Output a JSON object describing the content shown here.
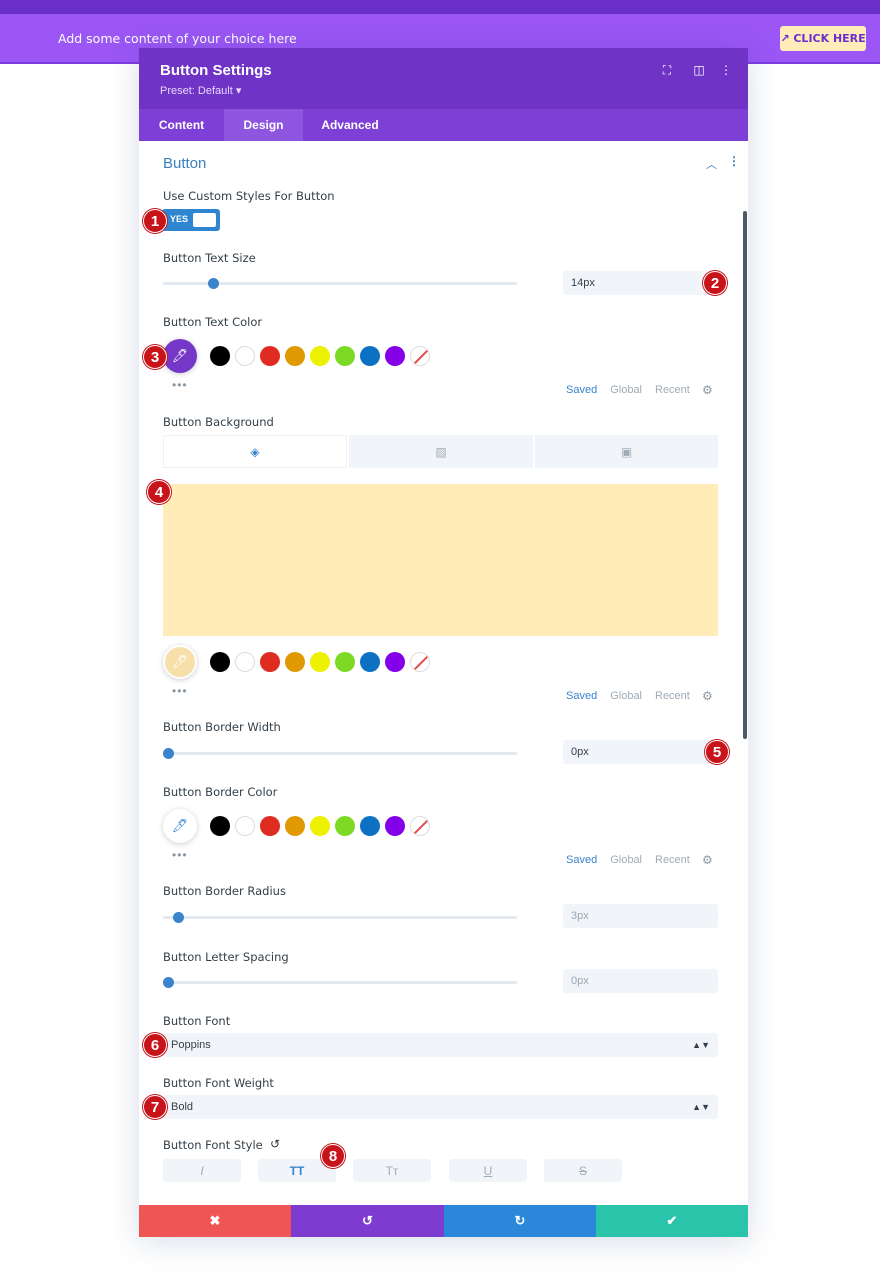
{
  "promo": {
    "text": "Add some content of your choice here",
    "button_label": "↗ CLICK HERE"
  },
  "modal": {
    "title": "Button Settings",
    "preset": "Preset: Default ▾",
    "tabs": [
      "Content",
      "Design",
      "Advanced"
    ],
    "active_tab": "Design"
  },
  "section": {
    "title": "Button"
  },
  "fields": {
    "custom_styles": {
      "label": "Use Custom Styles For Button",
      "toggle": "YES",
      "value": true
    },
    "text_size": {
      "label": "Button Text Size",
      "value": "14px",
      "slider_fraction": 0.14
    },
    "text_color": {
      "label": "Button Text Color"
    },
    "background": {
      "label": "Button Background",
      "color": "#ffecb8"
    },
    "border_width": {
      "label": "Button Border Width",
      "value": "0px",
      "slider_fraction": 0.0
    },
    "border_color": {
      "label": "Button Border Color"
    },
    "border_radius": {
      "label": "Button Border Radius",
      "value": "3px",
      "slider_fraction": 0.03
    },
    "letter_spacing": {
      "label": "Button Letter Spacing",
      "value": "0px",
      "slider_fraction": 0.0
    },
    "font": {
      "label": "Button Font",
      "value": "Poppins"
    },
    "font_weight": {
      "label": "Button Font Weight",
      "value": "Bold"
    },
    "font_style": {
      "label": "Button Font Style",
      "buttons": [
        "I",
        "TT",
        "Tт",
        "U",
        "S"
      ],
      "active": "TT"
    }
  },
  "palette": {
    "tabs": [
      "Saved",
      "Global",
      "Recent"
    ],
    "active": "Saved",
    "colors": [
      "#000000",
      "#ffffff",
      "#e02b20",
      "#e09900",
      "#edf000",
      "#7cda24",
      "#0c71c3",
      "#8300e9"
    ],
    "more": "•••"
  },
  "footer": {
    "cancel": "✖",
    "undo": "↺",
    "redo": "↻",
    "save": "✔",
    "colors": {
      "cancel": "#ef5555",
      "undo": "#7e3bd0",
      "redo": "#2b87da",
      "save": "#29c4a9"
    }
  },
  "badges": [
    "1",
    "2",
    "3",
    "4",
    "5",
    "6",
    "7",
    "8"
  ],
  "icons": {
    "header": [
      "fullscreen-icon",
      "split-view-icon",
      "more-vertical-icon"
    ],
    "eyedropper": "🖊"
  }
}
